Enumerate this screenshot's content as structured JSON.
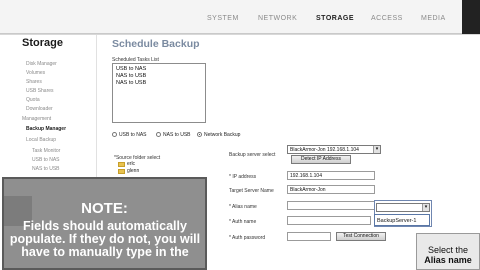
{
  "topbar": {
    "logo_text": "",
    "nav": [
      "SYSTEM",
      "NETWORK",
      "STORAGE",
      "ACCESS",
      "MEDIA"
    ],
    "active_nav": "STORAGE"
  },
  "sidebar": {
    "title": "Storage",
    "items": [
      {
        "label": "Disk Manager"
      },
      {
        "label": "Volumes"
      },
      {
        "label": "Shares"
      },
      {
        "label": "USB Shares"
      },
      {
        "label": "Quota"
      },
      {
        "label": "Downloader"
      },
      {
        "label": "Management"
      },
      {
        "label": "Backup Manager",
        "active": true
      },
      {
        "label": "Local Backup"
      },
      {
        "label": "Task Monitor"
      },
      {
        "label": "USB to NAS"
      },
      {
        "label": "NAS to USB"
      }
    ]
  },
  "main": {
    "title": "Schedule Backup",
    "tasks_label": "Scheduled Tasks List",
    "tasks": [
      "USB to NAS",
      "NAS to USB",
      "NAS to USB"
    ],
    "radio_options": [
      {
        "label": "USB to NAS",
        "selected": false
      },
      {
        "label": "NAS to USB",
        "selected": false
      },
      {
        "label": "Network Backup",
        "selected": true
      }
    ],
    "source_label": "*Source folder select",
    "folders": [
      "erlc",
      "glenn"
    ],
    "backup_server_label": "Backup server select",
    "backup_server_value": "BlackArmor-Jon 192.168.1.104",
    "detect_ip_button": "Detect IP Address",
    "ip_label": "* IP address",
    "ip_value": "192.168.1.104",
    "target_label": "Target Server Name",
    "target_value": "BlackArmor-Jon",
    "alias_label": "* Alias name",
    "auth_name_label": "* Auth name",
    "auth_password_label": "* Auth password",
    "test_connection_button": "Test Connection",
    "alias_dropdown_option": "BackupServer-1"
  },
  "note": {
    "heading": "NOTE:",
    "body": "Fields should automatically populate. If they do not, you will have to manually type in the"
  },
  "callout": {
    "line1": "Select the",
    "line2": "Alias name"
  },
  "colors": {
    "title_blue_gray": "#7a8aa0",
    "note_gray": "#8f8f8f",
    "highlight_border": "#6f86b0"
  }
}
